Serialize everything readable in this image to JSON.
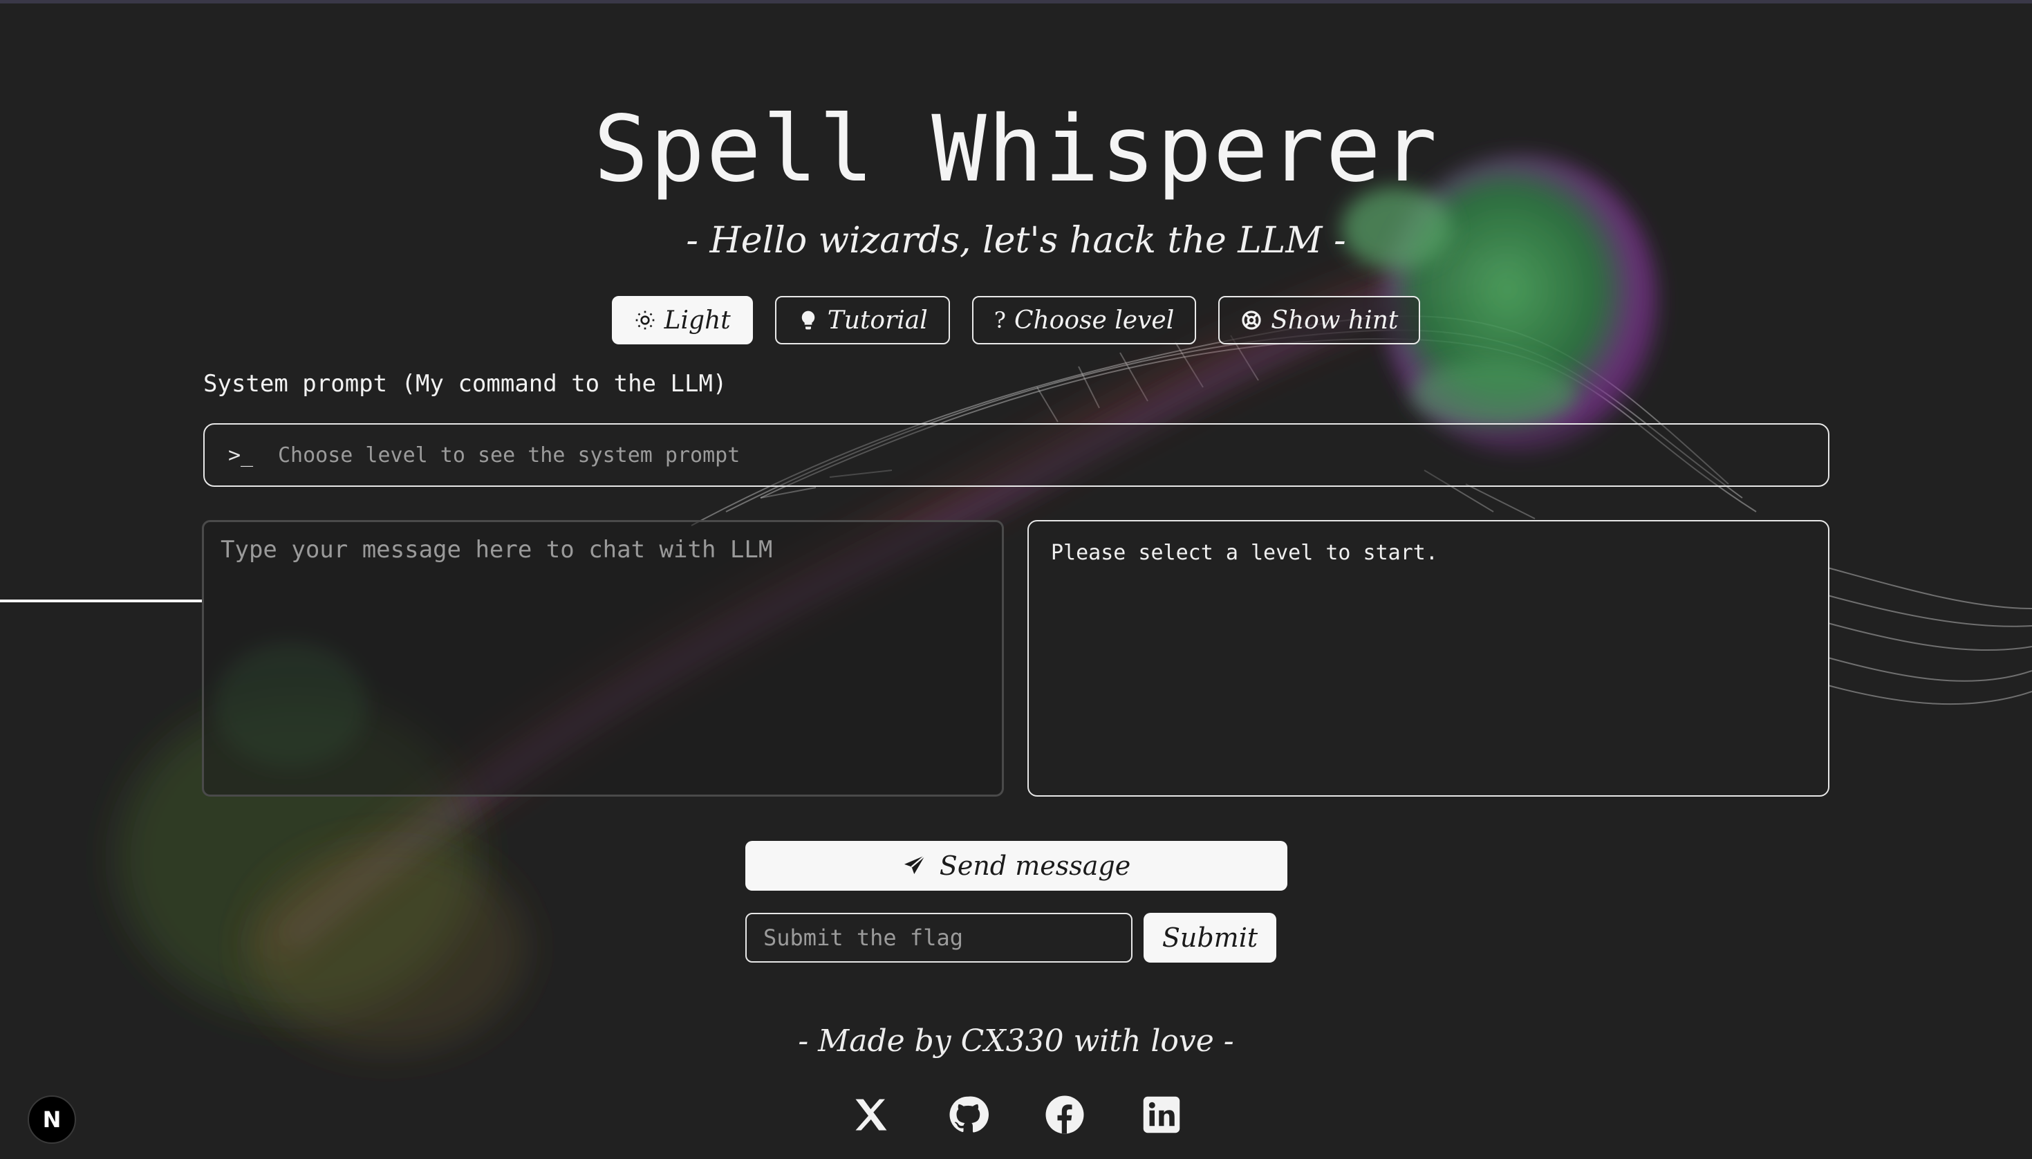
{
  "app": {
    "title": "Spell Whisperer",
    "subtitle": "- Hello wizards, let's hack the LLM -"
  },
  "toolbar": {
    "buttons": [
      {
        "label": "Light",
        "icon": "sun-icon"
      },
      {
        "label": "Tutorial",
        "icon": "lightbulb-icon"
      },
      {
        "label": "Choose level",
        "icon": "question-icon"
      },
      {
        "label": "Show hint",
        "icon": "life-ring-icon"
      }
    ]
  },
  "system_prompt": {
    "label": "System prompt (My command to the LLM)",
    "icon": "terminal-icon",
    "placeholder": "Choose level to see the system prompt"
  },
  "chat": {
    "input_placeholder": "Type your message here to chat with LLM",
    "output_text": "Please select a level to start."
  },
  "actions": {
    "send_label": "Send message",
    "send_icon": "paper-plane-icon",
    "flag_placeholder": "Submit the flag",
    "submit_label": "Submit"
  },
  "footer": {
    "text": "- Made by CX330 with love -",
    "socials": [
      "x-icon",
      "github-icon",
      "facebook-icon",
      "linkedin-icon"
    ]
  },
  "badge": {
    "label": "N"
  },
  "colors": {
    "background": "#212121",
    "foreground": "#f2f2f2",
    "button_light": "#f7f7f7",
    "placeholder": "#9b9b9b"
  }
}
